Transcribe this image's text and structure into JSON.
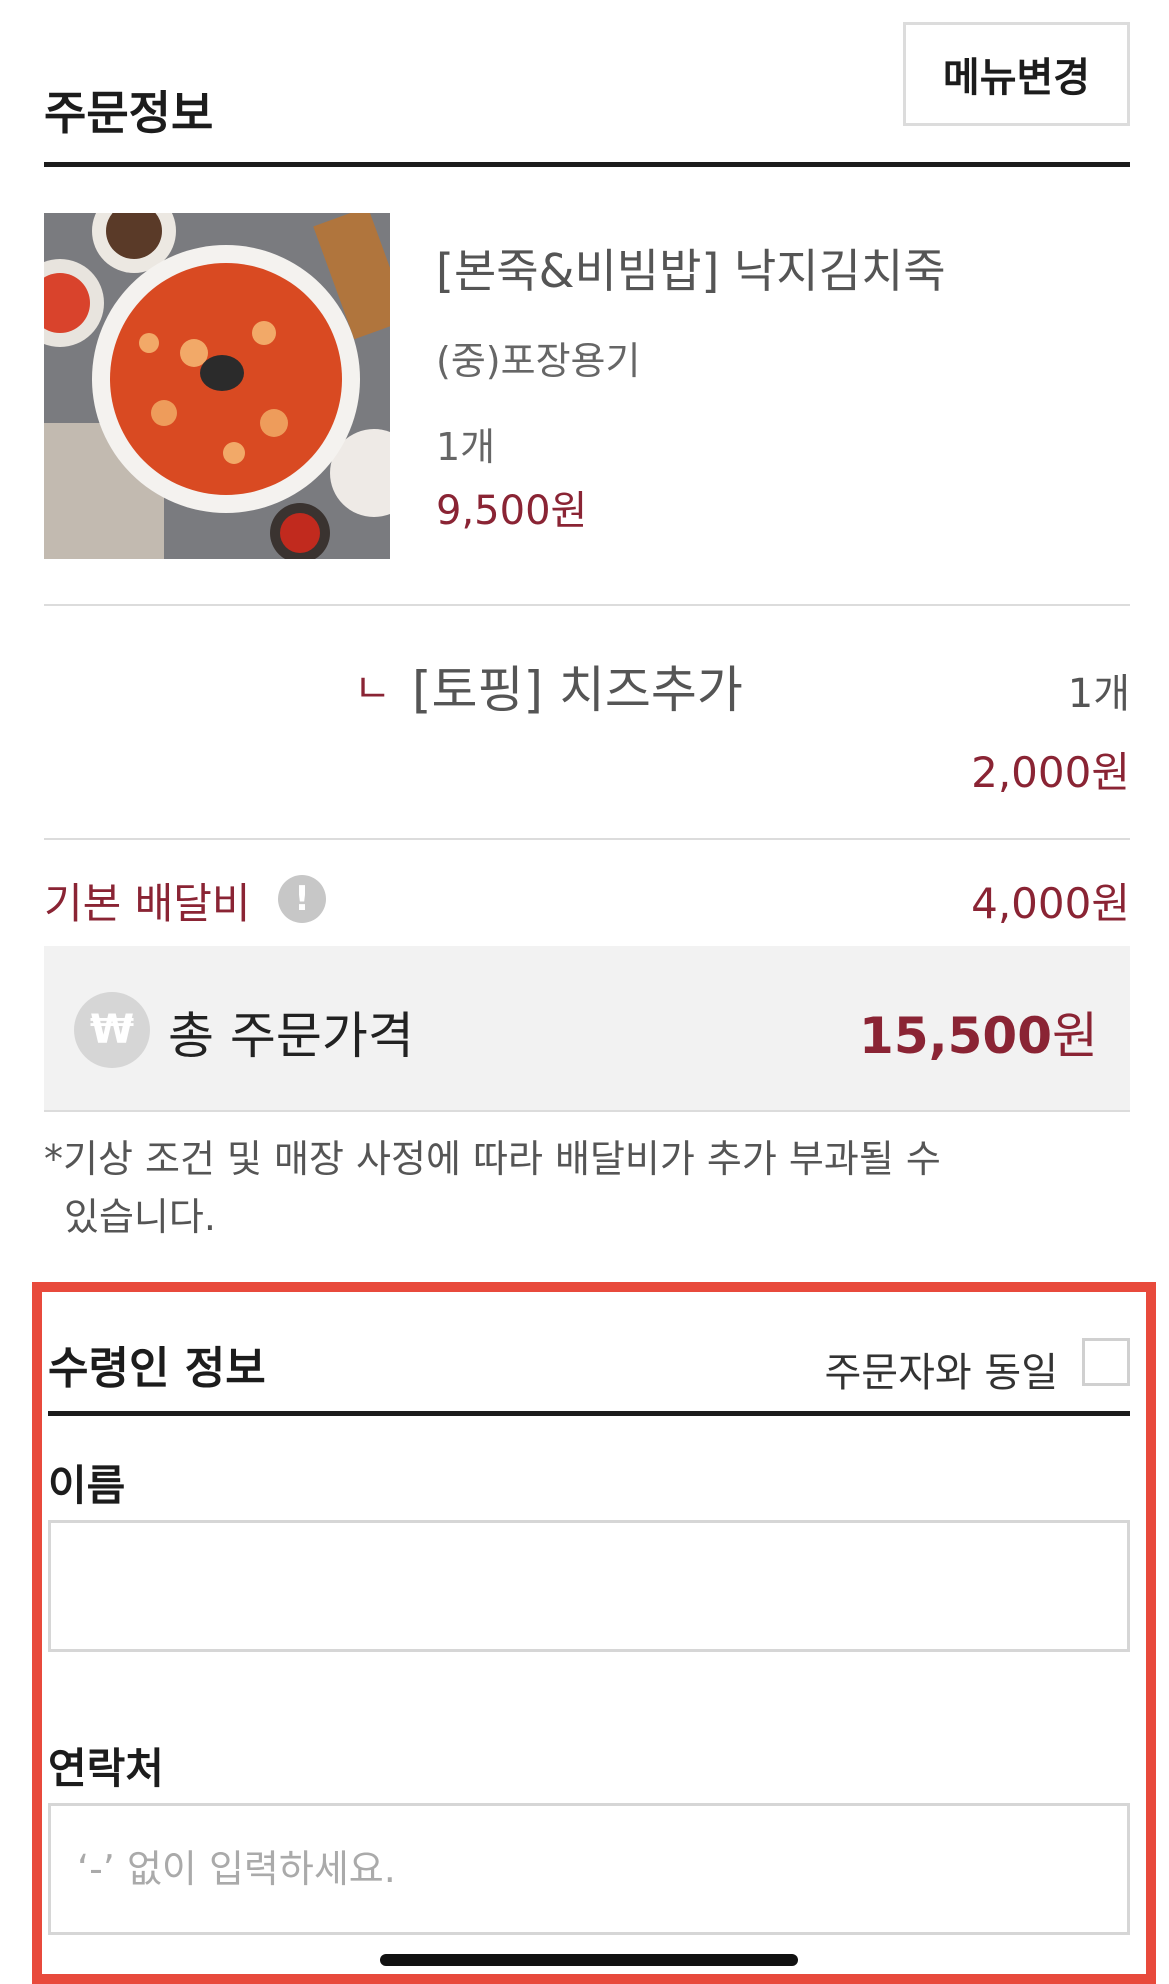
{
  "order_section": {
    "title": "주문정보",
    "menu_change_label": "메뉴변경"
  },
  "product": {
    "image_alt": "낙지김치죽",
    "name": "[본죽&비빔밥] 낙지김치죽",
    "package": "(중)포장용기",
    "quantity": "1개",
    "price": "9,500원"
  },
  "topping": {
    "arrow": "ㄴ",
    "name": "[토핑] 치즈추가",
    "quantity": "1개",
    "price": "2,000원"
  },
  "delivery_fee": {
    "label": "기본 배달비",
    "info_icon": "!",
    "value": "4,000원"
  },
  "total": {
    "icon": "₩",
    "label": "총 주문가격",
    "amount": "15,500",
    "unit": "원"
  },
  "notice": {
    "line1": "*기상 조건 및 매장 사정에 따라 배달비가 추가 부과될 수",
    "line2": "있습니다."
  },
  "recipient": {
    "title": "수령인 정보",
    "same_as_orderer_label": "주문자와 동일",
    "same_as_orderer_checked": false,
    "name_label": "이름",
    "name_value": "",
    "phone_label": "연락처",
    "phone_placeholder": "‘-’ 없이 입력하세요."
  },
  "colors": {
    "accent": "#8a2434",
    "highlight": "#e84a3c",
    "divider": "#1c1c1c",
    "muted_bg": "#f2f2f2"
  }
}
